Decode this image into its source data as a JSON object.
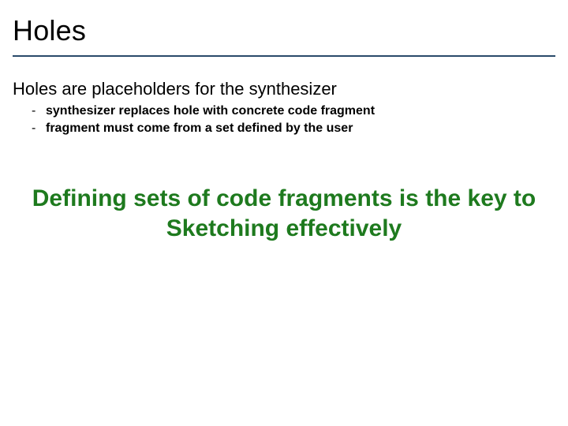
{
  "title": "Holes",
  "lead": "Holes are placeholders for the synthesizer",
  "bullets": [
    "synthesizer replaces hole with concrete code fragment",
    "fragment must come from a set defined by the user"
  ],
  "callout": "Defining sets of code fragments is the key to Sketching effectively",
  "colors": {
    "rule": "#2a4a6a",
    "accent": "#1e7a1e"
  }
}
